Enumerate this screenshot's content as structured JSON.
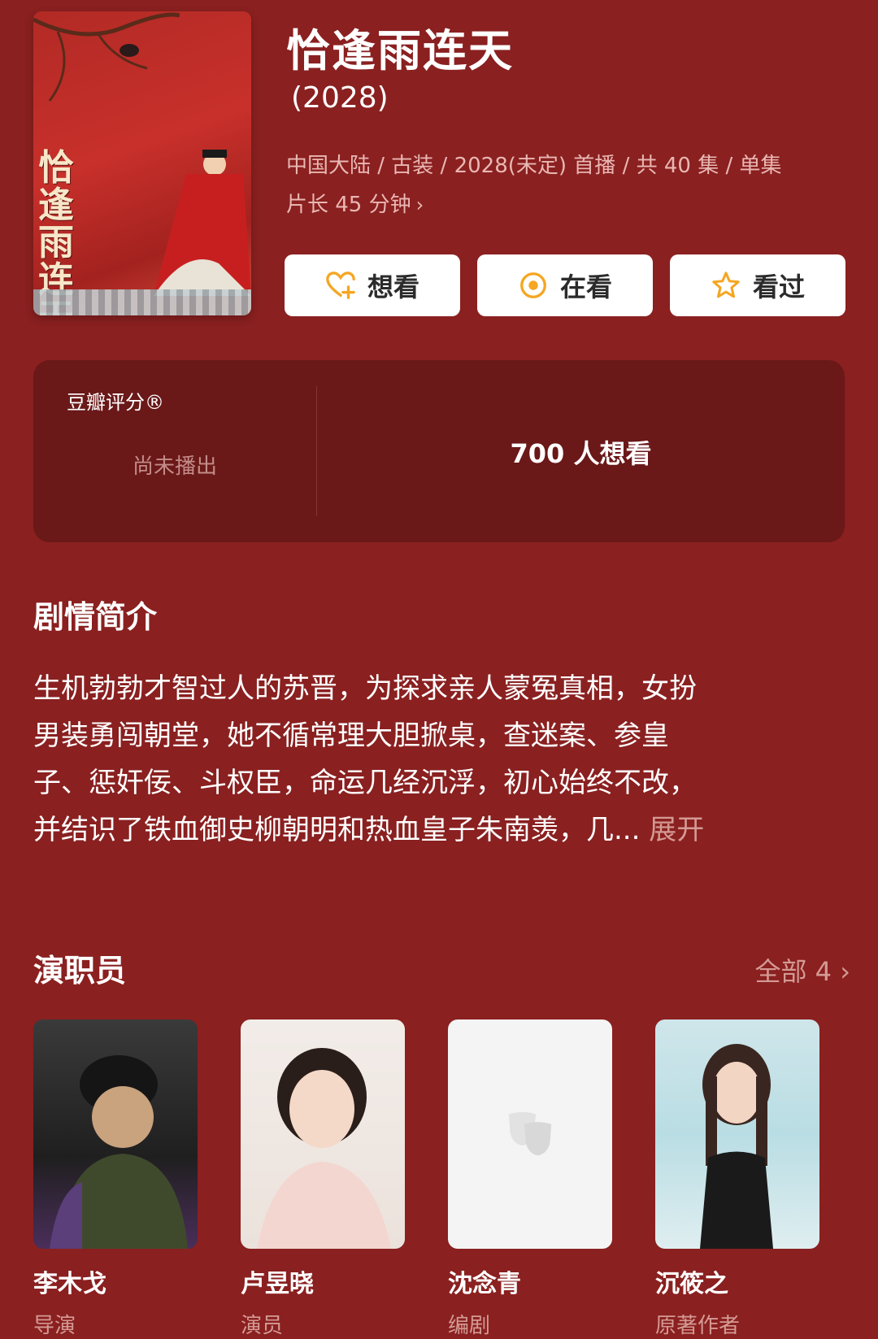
{
  "header": {
    "title": "恰逢雨连天",
    "year": "(2028)",
    "meta_line1": "中国大陆 / 古装 / 2028(未定) 首播 / 共 40 集 / 单集",
    "meta_line2": "片长 45 分钟",
    "poster_title": "恰逢雨连天"
  },
  "actions": {
    "want": "想看",
    "watching": "在看",
    "watched": "看过"
  },
  "rating": {
    "label": "豆瓣评分®",
    "status": "尚未播出",
    "wish_count": "700 人想看"
  },
  "synopsis": {
    "heading": "剧情简介",
    "line1": "生机勃勃才智过人的苏晋，为探求亲人蒙冤真相，女扮",
    "line2": "男装勇闯朝堂，她不循常理大胆掀桌，查迷案、参皇",
    "line3": "子、惩奸佞、斗权臣，命运几经沉浮，初心始终不改，",
    "line4": "并结识了铁血御史柳朝明和热血皇子朱南羡，几...",
    "expand": "展开"
  },
  "cast": {
    "heading": "演职员",
    "all_label": "全部 4",
    "members": [
      {
        "name": "李木戈",
        "role": "导演"
      },
      {
        "name": "卢昱晓",
        "role": "演员"
      },
      {
        "name": "沈念青",
        "role": "编剧"
      },
      {
        "name": "沉筱之",
        "role": "原著作者"
      }
    ]
  },
  "colors": {
    "background": "#8a2020",
    "card": "#6a1818",
    "accent": "#f5a623"
  }
}
